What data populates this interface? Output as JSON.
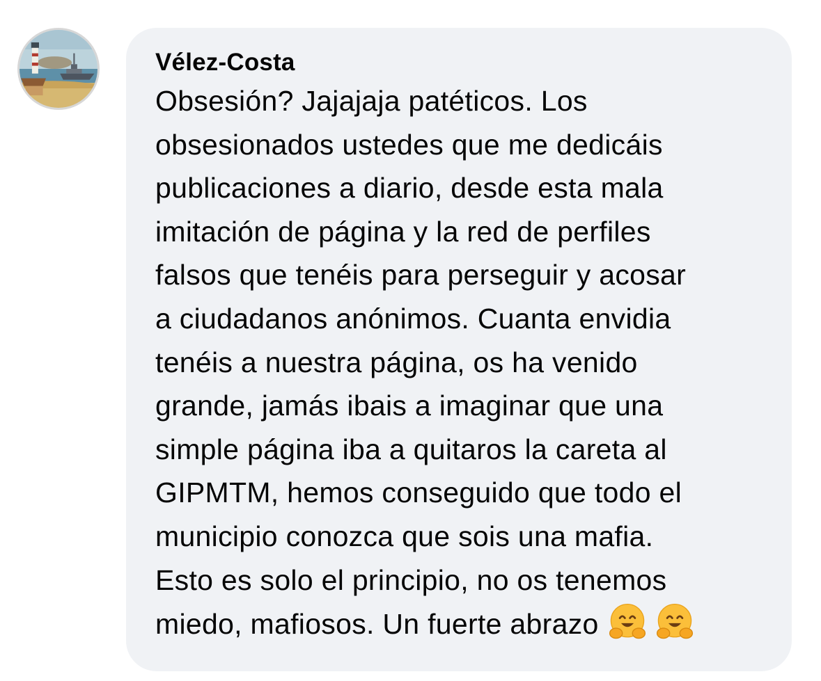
{
  "comment": {
    "author": "Vélez-Costa",
    "text_lines": [
      "Obsesión? Jajajaja patéticos. Los",
      "obsesionados ustedes que me dedicáis",
      "publicaciones a diario, desde esta mala",
      "imitación de página y la red de perfiles",
      "falsos que tenéis para perseguir y acosar",
      "a ciudadanos anónimos. Cuanta envidia",
      "tenéis a nuestra página, os ha venido",
      "grande, jamás ibais a imaginar que una",
      "simple página iba a quitaros la careta al",
      "GIPMTM, hemos conseguido que todo el",
      "municipio conozca que sois una mafia.",
      "Esto es solo el principio, no os tenemos",
      "miedo, mafiosos. Un fuerte abrazo"
    ],
    "emojis": [
      "hugging-face-emoji",
      "hugging-face-emoji"
    ],
    "avatar_icon": "lighthouse-ship-painting-avatar"
  },
  "colors": {
    "bubble_bg": "#f0f2f5",
    "text": "#050505",
    "emoji_face": "#fbbf3a"
  }
}
